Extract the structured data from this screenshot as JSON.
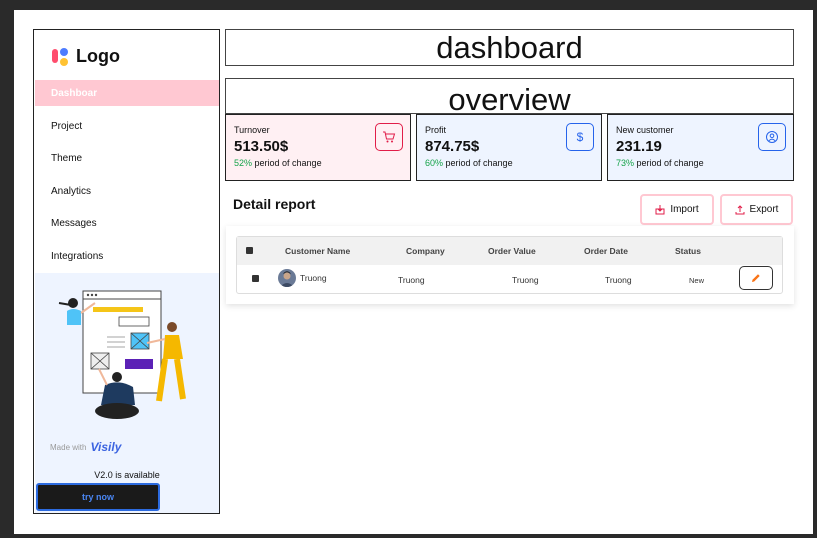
{
  "sidebar": {
    "logo_text": "Logo",
    "items": [
      {
        "label": "Dashboar",
        "active": true
      },
      {
        "label": "Project"
      },
      {
        "label": "Theme"
      },
      {
        "label": "Analytics"
      },
      {
        "label": "Messages"
      },
      {
        "label": "Integrations"
      }
    ],
    "promo": {
      "made_with": "Made with",
      "brand": "Visily",
      "version": "V2.0 is available",
      "cta": "try now"
    }
  },
  "header": {
    "title": "dashboard",
    "section": "overview"
  },
  "cards": [
    {
      "label": "Turnover",
      "value": "513.50$",
      "pct": "52%",
      "change": " period of change",
      "icon": "cart-icon",
      "accent": "#e11d48",
      "bg": "#fff0f3"
    },
    {
      "label": "Profit",
      "value": "874.75$",
      "pct": "60%",
      "change": " period of change",
      "icon": "dollar-icon",
      "accent": "#2563eb",
      "bg": "#eef4ff"
    },
    {
      "label": "New customer",
      "value": "231.19",
      "pct": "73%",
      "change": " period of change",
      "icon": "user-icon",
      "accent": "#2563eb",
      "bg": "#eef4ff"
    }
  ],
  "report": {
    "title": "Detail report",
    "import_label": "Import",
    "export_label": "Export",
    "columns": [
      "Customer Name",
      "Company",
      "Order Value",
      "Order Date",
      "Status"
    ],
    "rows": [
      {
        "customer": "Truong",
        "company": "Truong",
        "order_value": "Truong",
        "order_date": "Truong",
        "status": "New"
      }
    ]
  },
  "colors": {
    "active_nav": "#ffc8d2",
    "positive": "#16a34a",
    "button_border": "#ffc8d2"
  }
}
